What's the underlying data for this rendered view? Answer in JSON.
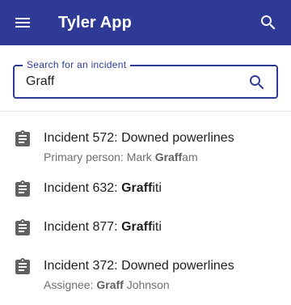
{
  "app": {
    "title": "Tyler App"
  },
  "search": {
    "label": "Search for an incident",
    "value": "Graff"
  },
  "results": [
    {
      "title_prefix": "Incident 572: Downed powerlines",
      "title_match": "",
      "title_suffix": "",
      "sub_prefix": "Primary person: Mark ",
      "sub_match": "Graff",
      "sub_suffix": "am",
      "icon": "clipboard-icon"
    },
    {
      "title_prefix": "Incident 632: ",
      "title_match": "Graff",
      "title_suffix": "iti",
      "icon": "clipboard-icon"
    },
    {
      "title_prefix": "Incident 877: ",
      "title_match": "Graff",
      "title_suffix": "iti",
      "icon": "clipboard-icon"
    },
    {
      "title_prefix": "Incident 372: Downed powerlines",
      "title_match": "",
      "title_suffix": "",
      "sub_prefix": "Assignee: ",
      "sub_match": "Graff",
      "sub_suffix": " Johnson",
      "icon": "clipboard-icon"
    }
  ],
  "colors": {
    "appbar": "#2e3a96",
    "accent": "#2e3a96"
  }
}
